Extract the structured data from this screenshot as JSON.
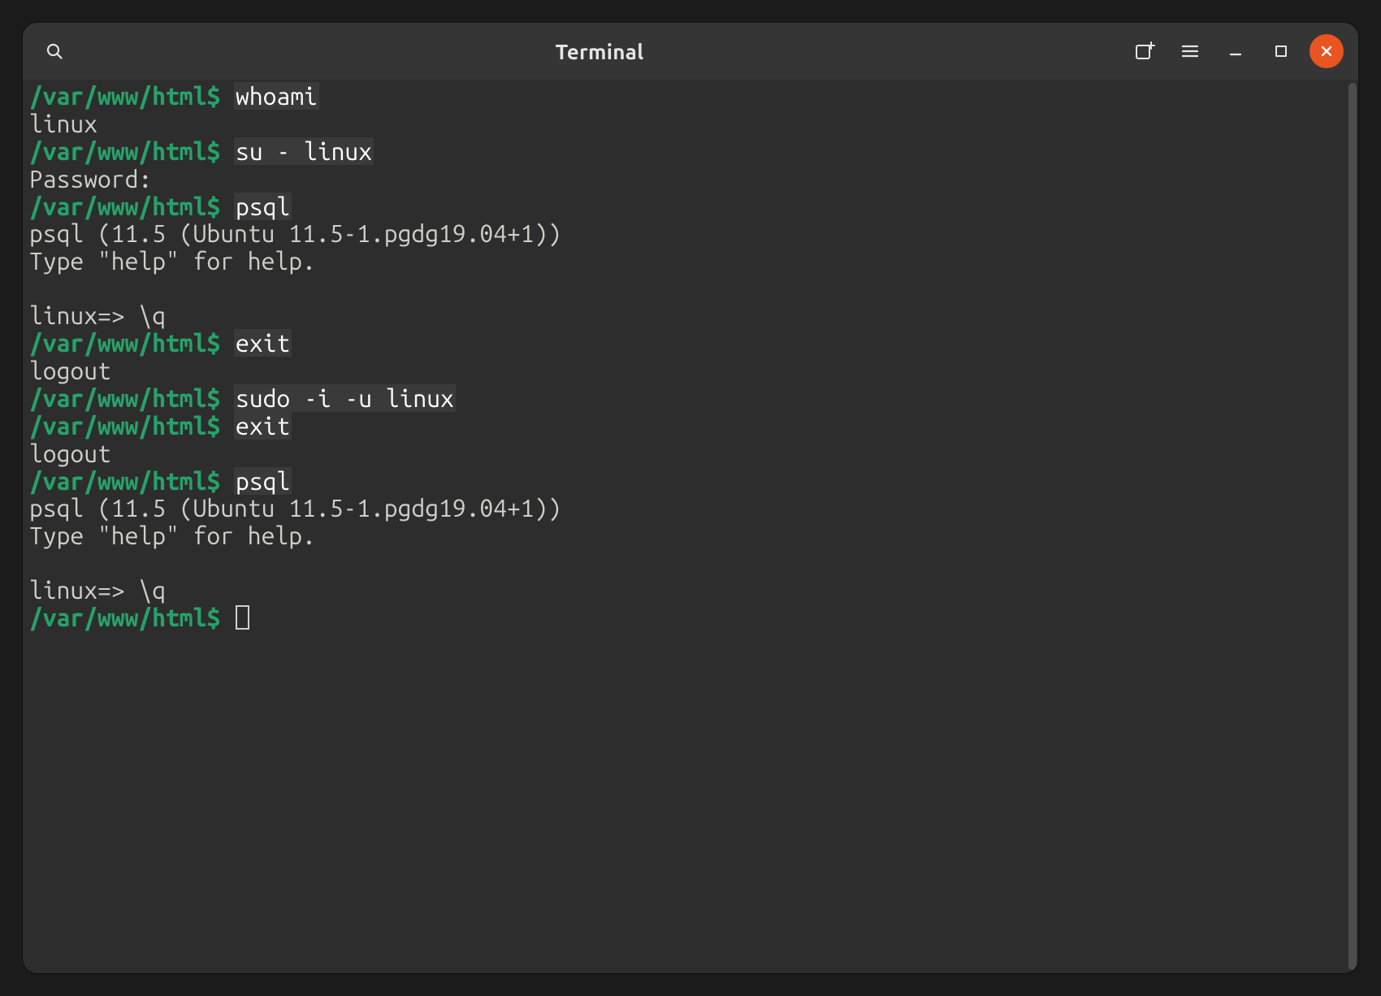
{
  "colors": {
    "bg_outer": "#1b1b1b",
    "bg_window": "#2d2d2d",
    "bg_titlebar": "#353535",
    "prompt_green": "#26a269",
    "cmd_bg": "#3a3a3a",
    "text": "#d0cfcc",
    "close_orange": "#e95420"
  },
  "titlebar": {
    "title": "Terminal",
    "icons": {
      "search": "search-icon",
      "new_tab": "new-tab-icon",
      "menu": "hamburger-icon",
      "minimize": "minimize-icon",
      "maximize": "maximize-icon",
      "close": "close-icon"
    }
  },
  "terminal": {
    "prompt_path": "/var/www/html",
    "prompt_sigil": "$",
    "lines": [
      {
        "type": "prompt",
        "cmd": "whoami"
      },
      {
        "type": "out",
        "text": "linux"
      },
      {
        "type": "prompt",
        "cmd": "su - linux"
      },
      {
        "type": "out",
        "text": "Password:"
      },
      {
        "type": "prompt",
        "cmd": "psql"
      },
      {
        "type": "out",
        "text": "psql (11.5 (Ubuntu 11.5-1.pgdg19.04+1))"
      },
      {
        "type": "out",
        "text": "Type \"help\" for help."
      },
      {
        "type": "blank"
      },
      {
        "type": "out",
        "text": "linux=> \\q"
      },
      {
        "type": "prompt",
        "cmd": "exit"
      },
      {
        "type": "out",
        "text": "logout"
      },
      {
        "type": "prompt",
        "cmd": "sudo -i -u linux"
      },
      {
        "type": "prompt",
        "cmd": "exit"
      },
      {
        "type": "out",
        "text": "logout"
      },
      {
        "type": "prompt",
        "cmd": "psql"
      },
      {
        "type": "out",
        "text": "psql (11.5 (Ubuntu 11.5-1.pgdg19.04+1))"
      },
      {
        "type": "out",
        "text": "Type \"help\" for help."
      },
      {
        "type": "blank"
      },
      {
        "type": "out",
        "text": "linux=> \\q"
      },
      {
        "type": "prompt_cursor"
      }
    ]
  }
}
